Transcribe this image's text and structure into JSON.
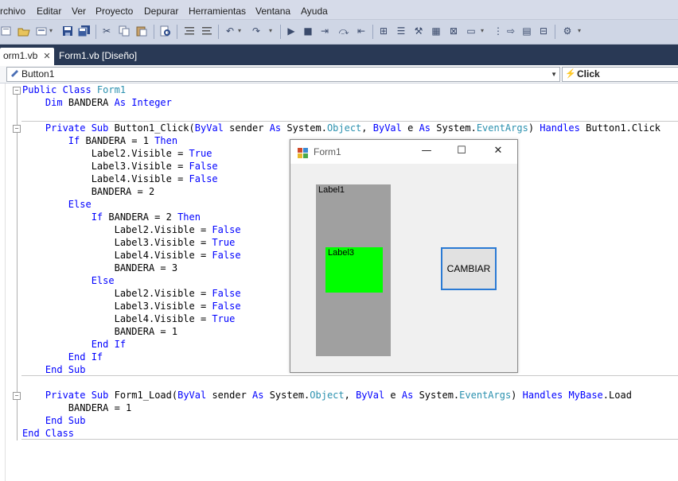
{
  "menubar": {
    "items": [
      {
        "label": "rchivo"
      },
      {
        "label": "Editar"
      },
      {
        "label": "Ver"
      },
      {
        "label": "Proyecto"
      },
      {
        "label": "Depurar"
      },
      {
        "label": "Herramientas"
      },
      {
        "label": "Ventana"
      },
      {
        "label": "Ayuda"
      }
    ]
  },
  "tabs": [
    {
      "label": "orm1.vb"
    },
    {
      "label": "Form1.vb [Diseño]"
    }
  ],
  "tab_close_glyph": "✕",
  "memberbar": {
    "object": "Button1",
    "event": "Click"
  },
  "code": {
    "lines": [
      [
        {
          "t": "Public Class ",
          "c": "kw"
        },
        {
          "t": "Form1",
          "c": "ty"
        }
      ],
      [
        {
          "t": "    "
        },
        {
          "t": "Dim",
          "c": "kw"
        },
        {
          "t": " BANDERA "
        },
        {
          "t": "As Integer",
          "c": "kw"
        }
      ],
      [],
      [
        {
          "t": "    "
        },
        {
          "t": "Private Sub",
          "c": "kw"
        },
        {
          "t": " Button1_Click("
        },
        {
          "t": "ByVal",
          "c": "kw"
        },
        {
          "t": " sender "
        },
        {
          "t": "As",
          "c": "kw"
        },
        {
          "t": " System."
        },
        {
          "t": "Object",
          "c": "ty"
        },
        {
          "t": ", "
        },
        {
          "t": "ByVal",
          "c": "kw"
        },
        {
          "t": " e "
        },
        {
          "t": "As",
          "c": "kw"
        },
        {
          "t": " System."
        },
        {
          "t": "EventArgs",
          "c": "ty"
        },
        {
          "t": ") "
        },
        {
          "t": "Handles",
          "c": "kw"
        },
        {
          "t": " Button1.Click"
        }
      ],
      [
        {
          "t": "        "
        },
        {
          "t": "If",
          "c": "kw"
        },
        {
          "t": " BANDERA = 1 "
        },
        {
          "t": "Then",
          "c": "kw"
        }
      ],
      [
        {
          "t": "            Label2.Visible = "
        },
        {
          "t": "True",
          "c": "kw"
        }
      ],
      [
        {
          "t": "            Label3.Visible = "
        },
        {
          "t": "False",
          "c": "kw"
        }
      ],
      [
        {
          "t": "            Label4.Visible = "
        },
        {
          "t": "False",
          "c": "kw"
        }
      ],
      [
        {
          "t": "            BANDERA = 2"
        }
      ],
      [
        {
          "t": "        "
        },
        {
          "t": "Else",
          "c": "kw"
        }
      ],
      [
        {
          "t": "            "
        },
        {
          "t": "If",
          "c": "kw"
        },
        {
          "t": " BANDERA = 2 "
        },
        {
          "t": "Then",
          "c": "kw"
        }
      ],
      [
        {
          "t": "                Label2.Visible = "
        },
        {
          "t": "False",
          "c": "kw"
        }
      ],
      [
        {
          "t": "                Label3.Visible = "
        },
        {
          "t": "True",
          "c": "kw"
        }
      ],
      [
        {
          "t": "                Label4.Visible = "
        },
        {
          "t": "False",
          "c": "kw"
        }
      ],
      [
        {
          "t": "                BANDERA = 3"
        }
      ],
      [
        {
          "t": "            "
        },
        {
          "t": "Else",
          "c": "kw"
        }
      ],
      [
        {
          "t": "                Label2.Visible = "
        },
        {
          "t": "False",
          "c": "kw"
        }
      ],
      [
        {
          "t": "                Label3.Visible = "
        },
        {
          "t": "False",
          "c": "kw"
        }
      ],
      [
        {
          "t": "                Label4.Visible = "
        },
        {
          "t": "True",
          "c": "kw"
        }
      ],
      [
        {
          "t": "                BANDERA = 1"
        }
      ],
      [
        {
          "t": "            "
        },
        {
          "t": "End If",
          "c": "kw"
        }
      ],
      [
        {
          "t": "        "
        },
        {
          "t": "End If",
          "c": "kw"
        }
      ],
      [
        {
          "t": "    "
        },
        {
          "t": "End Sub",
          "c": "kw"
        }
      ],
      [],
      [
        {
          "t": "    "
        },
        {
          "t": "Private Sub",
          "c": "kw"
        },
        {
          "t": " Form1_Load("
        },
        {
          "t": "ByVal",
          "c": "kw"
        },
        {
          "t": " sender "
        },
        {
          "t": "As",
          "c": "kw"
        },
        {
          "t": " System."
        },
        {
          "t": "Object",
          "c": "ty"
        },
        {
          "t": ", "
        },
        {
          "t": "ByVal",
          "c": "kw"
        },
        {
          "t": " e "
        },
        {
          "t": "As",
          "c": "kw"
        },
        {
          "t": " System."
        },
        {
          "t": "EventArgs",
          "c": "ty"
        },
        {
          "t": ") "
        },
        {
          "t": "Handles",
          "c": "kw"
        },
        {
          "t": " "
        },
        {
          "t": "MyBase",
          "c": "kw"
        },
        {
          "t": ".Load"
        }
      ],
      [
        {
          "t": "        BANDERA = 1"
        }
      ],
      [
        {
          "t": "    "
        },
        {
          "t": "End Sub",
          "c": "kw"
        }
      ],
      [
        {
          "t": "End Class",
          "c": "kw"
        }
      ]
    ]
  },
  "form1": {
    "title": "Form1",
    "minimize_glyph": "—",
    "maximize_glyph": "☐",
    "close_glyph": "✕",
    "label1": "Label1",
    "label3": "Label3",
    "label1_color": "#a0a0a0",
    "label3_color": "#00ff00",
    "button": "CAMBIAR",
    "button_border_color": "#2a7ad4"
  },
  "colors": {
    "keyword": "#0000ff",
    "type": "#2b91af",
    "tabstrip": "#293955"
  },
  "icons": [
    "new-project-icon",
    "open-icon",
    "add-item-icon",
    "save-icon",
    "save-all-icon",
    "cut-icon",
    "copy-icon",
    "paste-icon",
    "find-icon",
    "comment-icon",
    "uncomment-icon",
    "undo-icon",
    "redo-icon",
    "start-icon",
    "stop-icon",
    "step-into-icon",
    "step-over-icon",
    "step-out-icon",
    "solution-explorer-icon",
    "properties-icon",
    "toolbox-icon",
    "object-browser-icon",
    "error-list-icon",
    "immediate-icon",
    "breakpoint-icon",
    "bookmark-icon",
    "output-icon",
    "extension-icon"
  ]
}
